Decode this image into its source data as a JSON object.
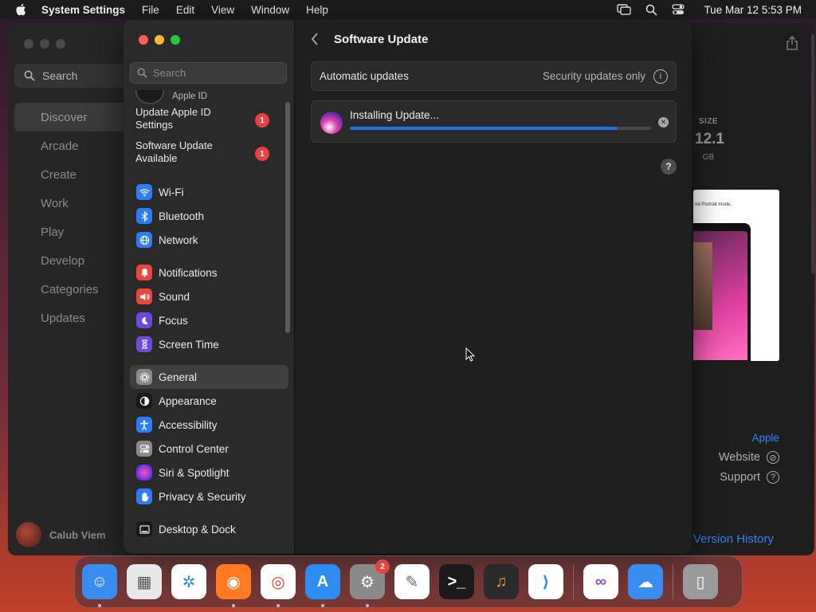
{
  "menubar": {
    "app_name": "System Settings",
    "menus": [
      "File",
      "Edit",
      "View",
      "Window",
      "Help"
    ],
    "clock": "Tue Mar 12  5:53 PM"
  },
  "appstore": {
    "search_label": "Search",
    "nav": [
      "Discover",
      "Arcade",
      "Create",
      "Work",
      "Play",
      "Develop",
      "Categories",
      "Updates"
    ],
    "user_name": "Calub Viem",
    "size_label": "SIZE",
    "size_value": "12.1",
    "size_unit": "GB",
    "preview_caption": "nd Portrait mode.",
    "developer": "Apple",
    "website_label": "Website",
    "support_label": "Support",
    "version_history": "Version History"
  },
  "settings": {
    "search_placeholder": "Search",
    "apple_id_label": "Apple ID",
    "notices": [
      {
        "text": "Update Apple ID Settings",
        "badge": "1"
      },
      {
        "text": "Software Update Available",
        "badge": "1"
      }
    ],
    "groups": [
      [
        {
          "label": "Wi-Fi",
          "icon": "wifi-icon",
          "color": "#2b7cf6"
        },
        {
          "label": "Bluetooth",
          "icon": "bluetooth-icon",
          "color": "#2b7cf6"
        },
        {
          "label": "Network",
          "icon": "globe-icon",
          "color": "#2b7cf6"
        }
      ],
      [
        {
          "label": "Notifications",
          "icon": "bell-icon",
          "color": "#e8453c"
        },
        {
          "label": "Sound",
          "icon": "speaker-icon",
          "color": "#e8453c"
        },
        {
          "label": "Focus",
          "icon": "moon-icon",
          "color": "#6a4ad8"
        },
        {
          "label": "Screen Time",
          "icon": "hourglass-icon",
          "color": "#6a4ad8"
        }
      ],
      [
        {
          "label": "General",
          "icon": "gear-icon",
          "color": "#8a8a8a",
          "active": true
        },
        {
          "label": "Appearance",
          "icon": "appearance-icon",
          "color": "#1a1a1a"
        },
        {
          "label": "Accessibility",
          "icon": "accessibility-icon",
          "color": "#2b7cf6"
        },
        {
          "label": "Control Center",
          "icon": "toggles-icon",
          "color": "#8a8a8a"
        },
        {
          "label": "Siri & Spotlight",
          "icon": "siri-icon",
          "color": "#b83ad8"
        },
        {
          "label": "Privacy & Security",
          "icon": "hand-icon",
          "color": "#2b7cf6"
        }
      ],
      [
        {
          "label": "Desktop & Dock",
          "icon": "dock-icon",
          "color": "#1a1a1a"
        }
      ]
    ],
    "page_title": "Software Update",
    "automatic_updates_label": "Automatic updates",
    "automatic_updates_value": "Security updates only",
    "install_label": "Installing Update...",
    "install_progress": 0.89
  },
  "dock": {
    "apps": [
      {
        "name": "finder-app",
        "color": "#3a8df0",
        "dot": true
      },
      {
        "name": "launchpad-app",
        "color": "#e8e8e8",
        "dot": false
      },
      {
        "name": "safari-app",
        "color": "#ffffff",
        "dot": false
      },
      {
        "name": "firefox-app",
        "color": "#ff7a20",
        "dot": true
      },
      {
        "name": "chrome-app",
        "color": "#ffffff",
        "dot": true
      },
      {
        "name": "app-store-app",
        "color": "#2d8cf0",
        "dot": true
      },
      {
        "name": "system-settings-app",
        "color": "#8a8a8a",
        "dot": true,
        "badge": "2"
      },
      {
        "name": "textedit-app",
        "color": "#ffffff",
        "dot": false
      },
      {
        "name": "terminal-app",
        "color": "#1a1a1a",
        "dot": false
      },
      {
        "name": "garageband-app",
        "color": "#2a2a2a",
        "dot": false
      },
      {
        "name": "vscode-app",
        "color": "#ffffff",
        "dot": false
      }
    ],
    "extras": [
      {
        "name": "visual-studio-app",
        "color": "#ffffff"
      },
      {
        "name": "weather-app",
        "color": "#3a8df0"
      }
    ],
    "trash": {
      "name": "trash-app",
      "color": "#9a9a9a"
    }
  }
}
